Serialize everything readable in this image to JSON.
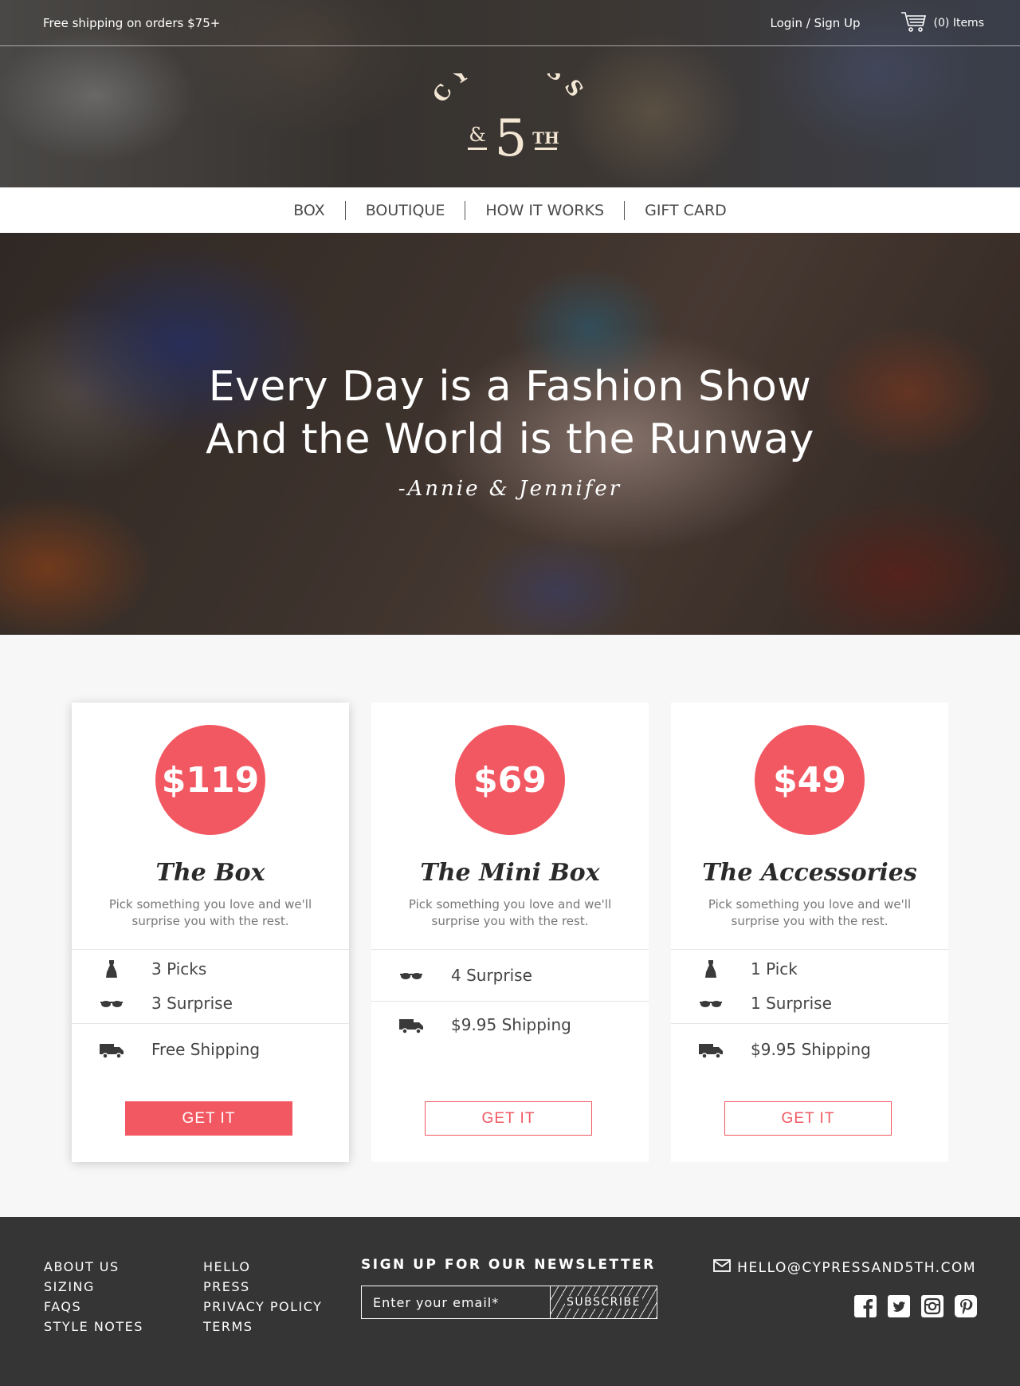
{
  "topbar": {
    "shipping_note": "Free shipping on orders $75+",
    "login": "Login / Sign Up",
    "cart_label": "(0) Items"
  },
  "logo": {
    "arc_text": "CYPRESS",
    "number": "5",
    "amp": "&",
    "suffix": "TH"
  },
  "nav": {
    "items": [
      "BOX",
      "BOUTIQUE",
      "HOW IT WORKS",
      "GIFT CARD"
    ]
  },
  "hero": {
    "line1": "Every Day is a Fashion Show",
    "line2": "And the World is the Runway",
    "signature": "-Annie & Jennifer"
  },
  "plans": [
    {
      "price": "$119",
      "title": "The Box",
      "description": "Pick something you love and we'll surprise you with the rest.",
      "features": [
        {
          "icon": "dress-icon",
          "text": "3 Picks"
        },
        {
          "icon": "glasses-icon",
          "text": "3 Surprise"
        }
      ],
      "shipping": {
        "icon": "truck-icon",
        "text": "Free Shipping"
      },
      "button": "GET IT"
    },
    {
      "price": "$69",
      "title": "The Mini Box",
      "description": "Pick something you love and we'll surprise you with the rest.",
      "features": [
        {
          "icon": "glasses-icon",
          "text": "4 Surprise"
        }
      ],
      "shipping": {
        "icon": "truck-icon",
        "text": "$9.95 Shipping"
      },
      "button": "GET IT"
    },
    {
      "price": "$49",
      "title": "The Accessories",
      "description": "Pick something you love and we'll surprise you with the rest.",
      "features": [
        {
          "icon": "dress-icon",
          "text": "1 Pick"
        },
        {
          "icon": "glasses-icon",
          "text": "1 Surprise"
        }
      ],
      "shipping": {
        "icon": "truck-icon",
        "text": "$9.95 Shipping"
      },
      "button": "GET IT"
    }
  ],
  "footer": {
    "col1": [
      "ABOUT US",
      "SIZING",
      "FAQS",
      "STYLE NOTES"
    ],
    "col2": [
      "HELLO",
      "PRESS",
      "PRIVACY POLICY",
      "TERMS"
    ],
    "newsletter_title": "SIGN UP FOR OUR NEWSLETTER",
    "email_placeholder": "Enter your email*",
    "subscribe": "SUBSCRIBE",
    "contact_email": "HELLO@CYPRESSAND5TH.COM",
    "socials": [
      "facebook-icon",
      "twitter-icon",
      "instagram-icon",
      "pinterest-icon"
    ]
  },
  "colors": {
    "accent": "#f25862",
    "footer_bg": "#353535",
    "header_text": "#ffffff",
    "logo_cream": "#f3e6d3"
  }
}
